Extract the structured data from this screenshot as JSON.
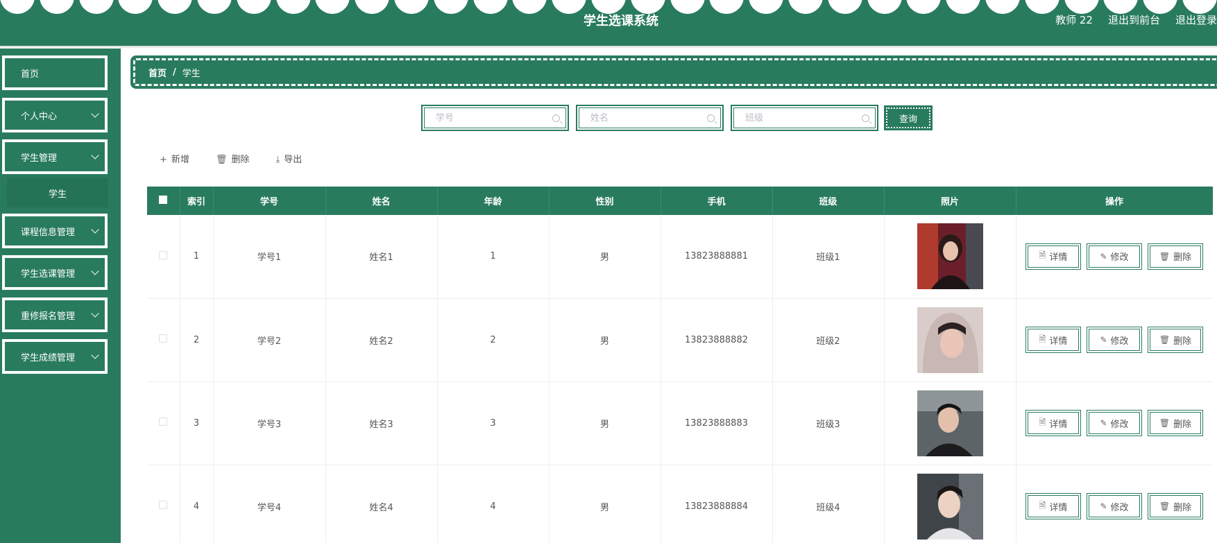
{
  "header": {
    "title": "学生选课系统",
    "user": "教师 22",
    "to_front": "退出到前台",
    "logout": "退出登录"
  },
  "sidebar": {
    "items": [
      {
        "label": "首页"
      },
      {
        "label": "个人中心"
      },
      {
        "label": "学生管理"
      },
      {
        "label": "学生"
      },
      {
        "label": "课程信息管理"
      },
      {
        "label": "学生选课管理"
      },
      {
        "label": "重修报名管理"
      },
      {
        "label": "学生成绩管理"
      }
    ]
  },
  "breadcrumb": {
    "home": "首页",
    "separator": "/",
    "current": "学生"
  },
  "search": {
    "student_no_placeholder": "学号",
    "name_placeholder": "姓名",
    "class_placeholder": "班级",
    "query_label": "查询"
  },
  "toolbar": {
    "add": "新增",
    "delete": "删除",
    "export": "导出"
  },
  "table": {
    "headers": {
      "index": "索引",
      "student_no": "学号",
      "name": "姓名",
      "age": "年龄",
      "gender": "性别",
      "phone": "手机",
      "class": "班级",
      "photo": "照片",
      "actions": "操作"
    },
    "rows": [
      {
        "index": "1",
        "student_no": "学号1",
        "name": "姓名1",
        "age": "1",
        "gender": "男",
        "phone": "13823888881",
        "class": "班级1"
      },
      {
        "index": "2",
        "student_no": "学号2",
        "name": "姓名2",
        "age": "2",
        "gender": "男",
        "phone": "13823888882",
        "class": "班级2"
      },
      {
        "index": "3",
        "student_no": "学号3",
        "name": "姓名3",
        "age": "3",
        "gender": "男",
        "phone": "13823888883",
        "class": "班级3"
      },
      {
        "index": "4",
        "student_no": "学号4",
        "name": "姓名4",
        "age": "4",
        "gender": "男",
        "phone": "13823888884",
        "class": "班级4"
      }
    ],
    "actions": {
      "detail": "详情",
      "edit": "修改",
      "delete": "删除"
    }
  },
  "icons": {
    "add": "plus-icon",
    "delete": "trash-icon",
    "export": "download-icon",
    "detail": "document-icon",
    "edit": "pencil-icon",
    "search": "search-icon"
  },
  "colors": {
    "primary": "#297b5e",
    "white": "#ffffff"
  }
}
